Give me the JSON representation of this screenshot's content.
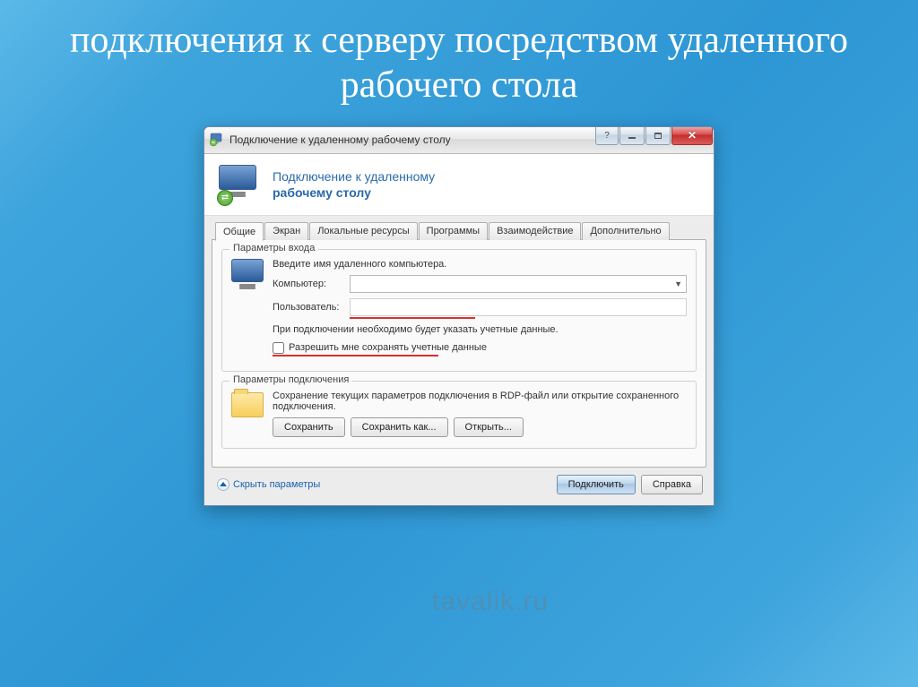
{
  "slide_title": "подключения к серверу посредством удаленного рабочего стола",
  "window": {
    "title": "Подключение к удаленному рабочему столу",
    "header_line1": "Подключение к удаленному",
    "header_line2": "рабочему столу"
  },
  "tabs": [
    "Общие",
    "Экран",
    "Локальные ресурсы",
    "Программы",
    "Взаимодействие",
    "Дополнительно"
  ],
  "group_login": {
    "title": "Параметры входа",
    "instruction": "Введите имя удаленного компьютера.",
    "computer_label": "Компьютер:",
    "computer_value": "",
    "user_label": "Пользователь:",
    "user_value": "",
    "note": "При подключении необходимо будет указать учетные данные.",
    "checkbox_label": "Разрешить мне сохранять учетные данные"
  },
  "group_conn": {
    "title": "Параметры подключения",
    "text": "Сохранение текущих параметров подключения в RDP-файл или открытие сохраненного подключения.",
    "save": "Сохранить",
    "save_as": "Сохранить как...",
    "open": "Открыть..."
  },
  "footer": {
    "hide": "Скрыть параметры",
    "connect": "Подключить",
    "help": "Справка"
  },
  "watermark": "tavalik.ru"
}
